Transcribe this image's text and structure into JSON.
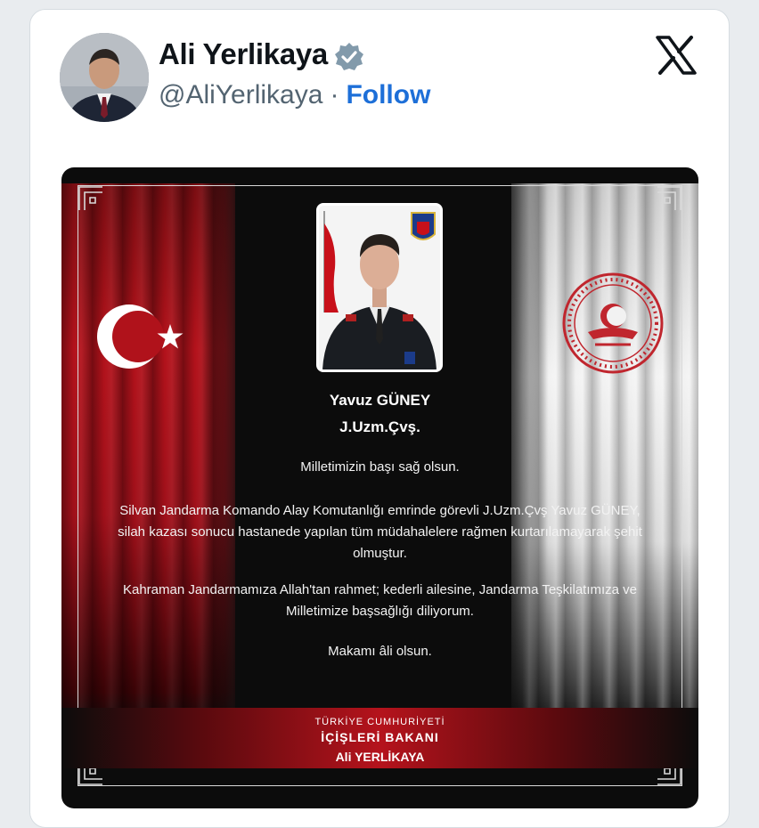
{
  "tweet": {
    "author_name": "Ali Yerlikaya",
    "handle": "@AliYerlikaya",
    "separator": "·",
    "follow_label": "Follow"
  },
  "post_image": {
    "soldier_name": "Yavuz GÜNEY",
    "soldier_rank": "J.Uzm.Çvş.",
    "messages": [
      "Milletimizin başı sağ olsun.",
      "Silvan Jandarma Komando Alay Komutanlığı emrinde görevli J.Uzm.Çvş Yavuz GÜNEY, silah kazası sonucu hastanede yapılan tüm müdahalelere rağmen kurtarılamayarak şehit olmuştur.",
      "Kahraman Jandarmamıza Allah'tan rahmet; kederli ailesine, Jandarma Teşkilatımıza ve Milletimize başsağlığı diliyorum.",
      "Makamı âli olsun."
    ],
    "banner": {
      "line1": "TÜRKİYE CUMHURİYETİ",
      "line2": "İÇİŞLERİ BAKANI",
      "line3": "Ali YERLİKAYA"
    }
  },
  "colors": {
    "follow_blue": "#1d6fd8",
    "verified_gray": "#829aab",
    "flag_red": "#b3121b"
  },
  "icons": [
    "verified-badge-icon",
    "x-logo-icon"
  ]
}
